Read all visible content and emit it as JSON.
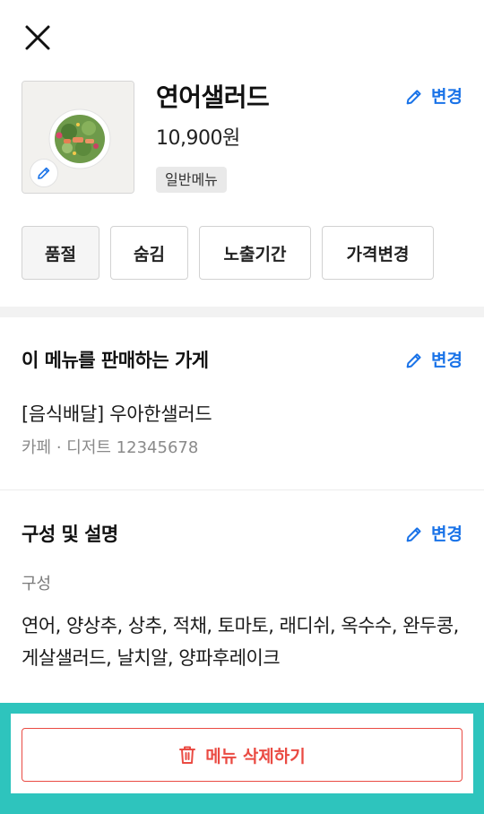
{
  "header": {
    "close_icon": "close-icon"
  },
  "product": {
    "name": "연어샐러드",
    "price": "10,900원",
    "badge": "일반메뉴",
    "image_icon": "salad-photo",
    "edit_label": "변경"
  },
  "actions": [
    {
      "label": "품절",
      "active": true
    },
    {
      "label": "숨김",
      "active": false
    },
    {
      "label": "노출기간",
      "active": false
    },
    {
      "label": "가격변경",
      "active": false
    }
  ],
  "store_section": {
    "title": "이 메뉴를 판매하는 가게",
    "edit_label": "변경",
    "store_name": "[음식배달] 우아한샐러드",
    "store_meta": "카페 · 디저트 12345678"
  },
  "composition_section": {
    "title": "구성 및 설명",
    "edit_label": "변경",
    "sub_label": "구성",
    "text": "연어, 양상추, 상추, 적채, 토마토, 래디쉬, 옥수수, 완두콩, 게살샐러드, 날치알, 양파후레이크"
  },
  "footer": {
    "delete_label": "메뉴 삭제하기",
    "delete_icon": "trash-icon"
  },
  "colors": {
    "accent_blue": "#1a73e8",
    "danger_red": "#ea4b43",
    "footer_teal": "#2ec4bd"
  }
}
